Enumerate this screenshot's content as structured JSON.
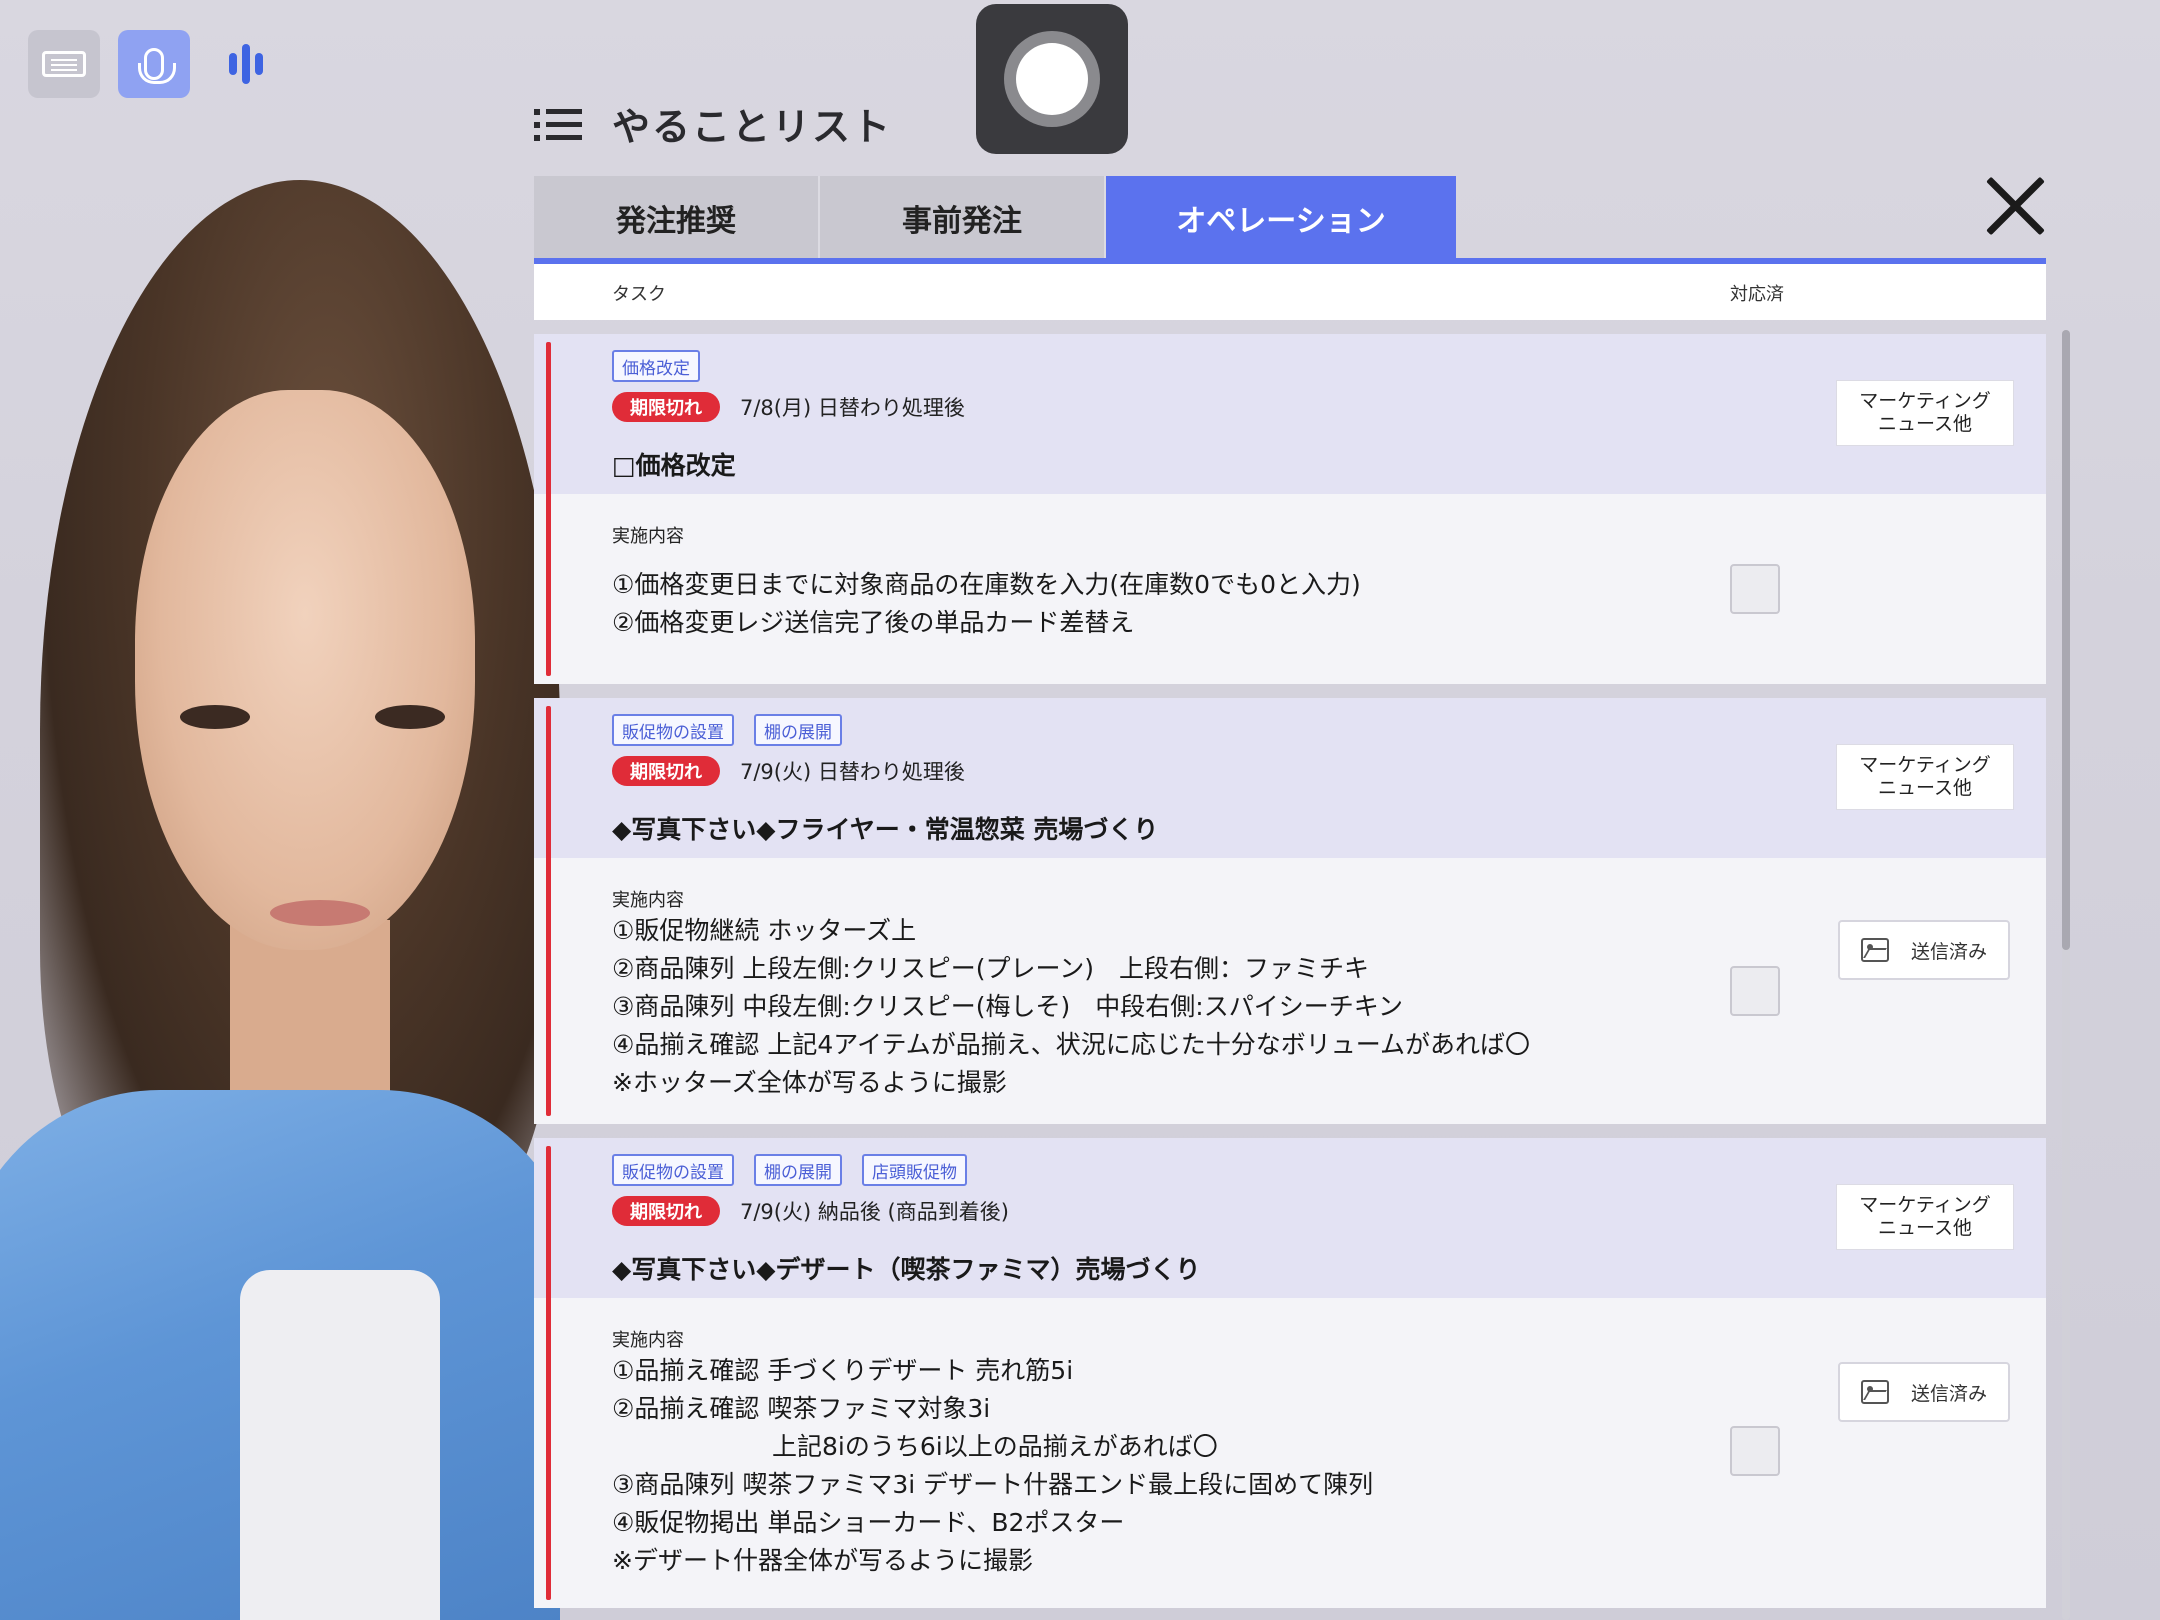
{
  "header": {
    "title": "やることリスト"
  },
  "tabs": [
    {
      "label": "発注推奨"
    },
    {
      "label": "事前発注"
    },
    {
      "label": "オペレーション",
      "active": true
    }
  ],
  "table": {
    "col_task": "タスク",
    "col_done": "対応済"
  },
  "colors": {
    "accent": "#5b72ee",
    "expired": "#e02c38",
    "card_top": "#e3e2f3"
  },
  "icons": [
    "keyboard-icon",
    "mic-icon",
    "voice-wave-icon",
    "record-icon",
    "list-icon",
    "close-icon",
    "image-icon"
  ],
  "cards": [
    {
      "tags": [
        "価格改定"
      ],
      "badge": "期限切れ",
      "date": "7/8(月) 日替わり処理後",
      "title": "□価格改定",
      "marketing": {
        "line1": "マーケティング",
        "line2": "ニュース他"
      },
      "impl_label": "実施内容",
      "lines": [
        "①価格変更日までに対象商品の在庫数を入力(在庫数0でも0と入力)",
        "②価格変更レジ送信完了後の単品カード差替え"
      ]
    },
    {
      "tags": [
        "販促物の設置",
        "棚の展開"
      ],
      "badge": "期限切れ",
      "date": "7/9(火) 日替わり処理後",
      "title": "◆写真下さい◆フライヤー・常温惣菜 売場づくり",
      "marketing": {
        "line1": "マーケティング",
        "line2": "ニュース他"
      },
      "impl_label": "実施内容",
      "lines": [
        "①販促物継続 ホッターズ上",
        "②商品陳列 上段左側:クリスピー(プレーン)　上段右側：ファミチキ",
        "③商品陳列 中段左側:クリスピー(梅しそ)　中段右側:スパイシーチキン",
        "④品揃え確認 上記4アイテムが品揃え、状況に応じた十分なボリュームがあれば〇",
        "※ホッターズ全体が写るように撮影"
      ],
      "sent": "送信済み"
    },
    {
      "tags": [
        "販促物の設置",
        "棚の展開",
        "店頭販促物"
      ],
      "badge": "期限切れ",
      "date": "7/9(火) 納品後 (商品到着後)",
      "title": "◆写真下さい◆デザート（喫茶ファミマ）売場づくり",
      "marketing": {
        "line1": "マーケティング",
        "line2": "ニュース他"
      },
      "impl_label": "実施内容",
      "lines": [
        "①品揃え確認 手づくりデザート 売れ筋5i",
        "②品揃え確認 喫茶ファミマ対象3i",
        "上記8iのうち6i以上の品揃えがあれば〇",
        "③商品陳列 喫茶ファミマ3i デザート什器エンド最上段に固めて陳列",
        "④販促物掲出 単品ショーカード、B2ポスター",
        "※デザート什器全体が写るように撮影"
      ],
      "sent": "送信済み"
    }
  ]
}
